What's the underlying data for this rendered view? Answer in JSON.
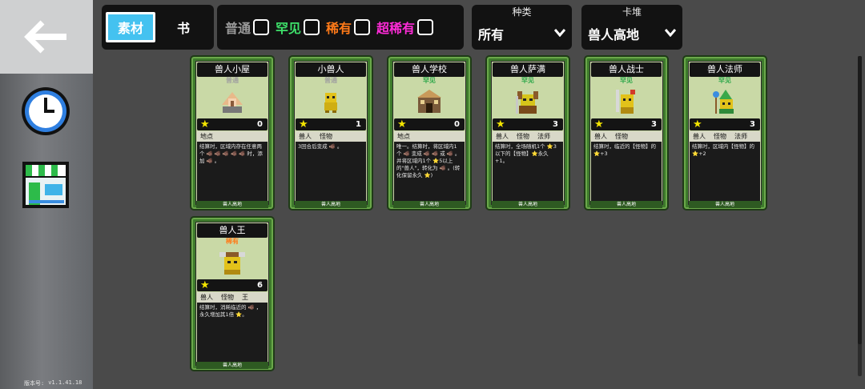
{
  "sidebar": {
    "version_label": "版本号:",
    "version_value": "v1.1.41.18"
  },
  "tabs": [
    {
      "label": "素材",
      "active": true
    },
    {
      "label": "书",
      "active": false
    }
  ],
  "rarity_filters": [
    {
      "label": "普通",
      "color": "#9a9a9a"
    },
    {
      "label": "罕见",
      "color": "#3ee06a"
    },
    {
      "label": "稀有",
      "color": "#ff7a18"
    },
    {
      "label": "超稀有",
      "color": "#ff2bd8"
    }
  ],
  "filters": {
    "kind": {
      "title": "种类",
      "value": "所有"
    },
    "pile": {
      "title": "卡堆",
      "value": "兽人高地"
    }
  },
  "cards": [
    {
      "name": "兽人小屋",
      "rarity": "普通",
      "rarity_color": "#a0a0a0",
      "cost": "0",
      "tags": [
        "地点"
      ],
      "desc": "结算时，区域内存在任意两个 🐗 🐗 🐗 🐗 🐗 时，添加 🐗 。",
      "footer": "兽人高地",
      "art": "hut"
    },
    {
      "name": "小兽人",
      "rarity": "普通",
      "rarity_color": "#a0a0a0",
      "cost": "1",
      "tags": [
        "兽人",
        "怪物"
      ],
      "desc": "3回合后变成 🐗 。",
      "footer": "兽人高地",
      "art": "small"
    },
    {
      "name": "兽人学校",
      "rarity": "罕见",
      "rarity_color": "#2fa84a",
      "cost": "0",
      "tags": [
        "地点"
      ],
      "desc": "唯一。结算时，将区域内1个 🐗 变成 🐗 🐗 或 🐗 。并将区域内1个 ⭐5以上的\"兽人\"，转化为 🐗 。(转化保留永久 ⭐)",
      "footer": "兽人高地",
      "art": "school"
    },
    {
      "name": "兽人萨满",
      "rarity": "罕见",
      "rarity_color": "#2fa84a",
      "cost": "3",
      "tags": [
        "兽人",
        "怪物",
        "法师"
      ],
      "desc": "结算时，全场随机1个 ⭐3以下的【怪物】⭐永久+1。",
      "footer": "兽人高地",
      "art": "shaman"
    },
    {
      "name": "兽人战士",
      "rarity": "罕见",
      "rarity_color": "#2fa84a",
      "cost": "3",
      "tags": [
        "兽人",
        "怪物"
      ],
      "desc": "结算时，临近的【怪物】的 ⭐+3",
      "footer": "兽人高地",
      "art": "warrior"
    },
    {
      "name": "兽人法师",
      "rarity": "罕见",
      "rarity_color": "#2fa84a",
      "cost": "3",
      "tags": [
        "兽人",
        "怪物",
        "法师"
      ],
      "desc": "结算时，区域内【怪物】的 ⭐+2",
      "footer": "兽人高地",
      "art": "mage"
    },
    {
      "name": "兽人王",
      "rarity": "稀有",
      "rarity_color": "#ff7a18",
      "cost": "6",
      "tags": [
        "兽人",
        "怪物",
        "王"
      ],
      "desc": "结算时，消耗临近的 🐗 ，永久增加其1倍 ⭐。",
      "footer": "兽人高地",
      "art": "king"
    }
  ]
}
